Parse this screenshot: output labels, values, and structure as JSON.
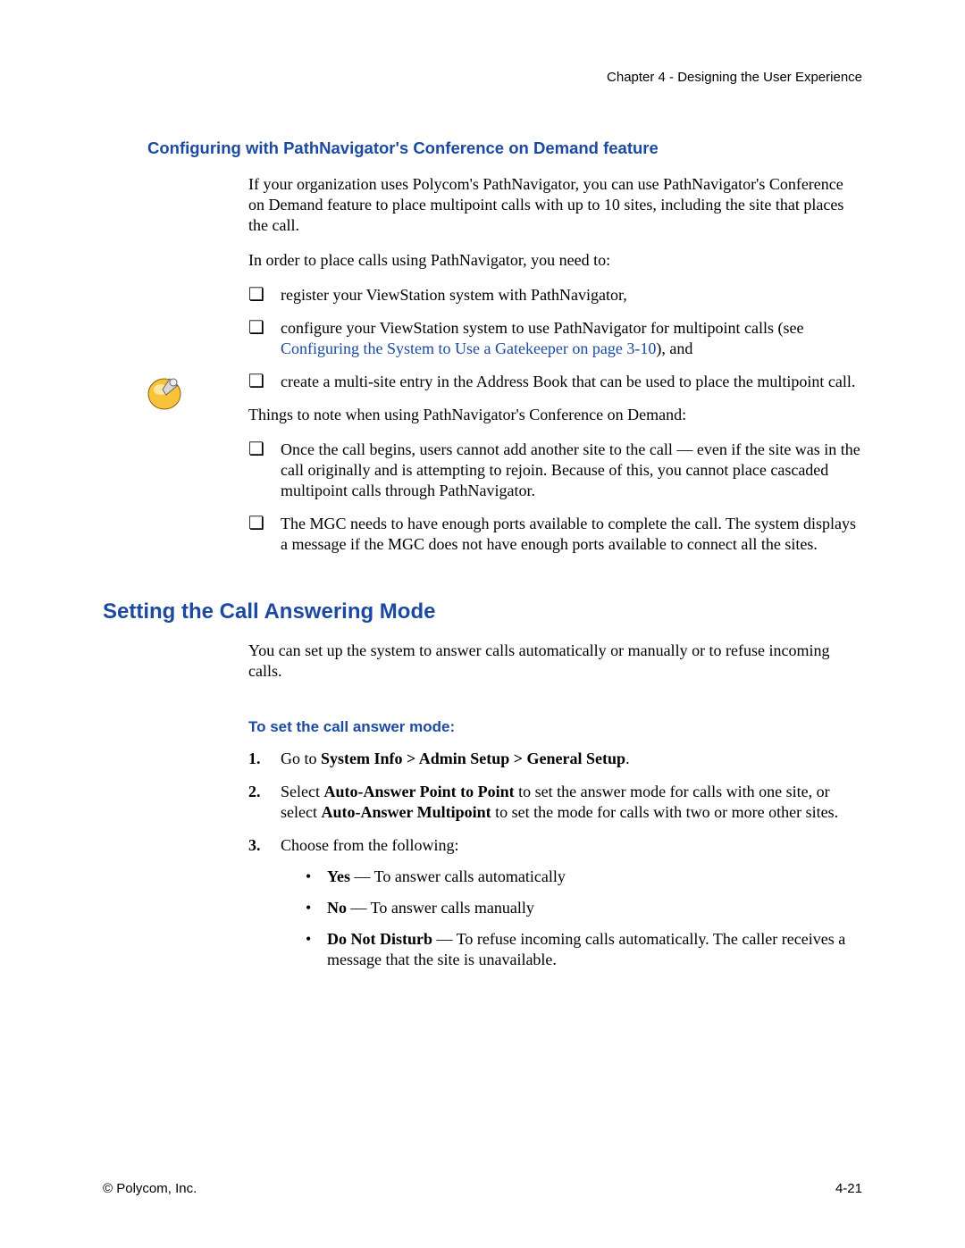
{
  "header": {
    "chapterLine": "Chapter 4 - Designing the User Experience"
  },
  "section1": {
    "heading": "Configuring with PathNavigator's Conference on Demand feature",
    "para1": "If your organization uses Polycom's PathNavigator, you can use PathNavigator's Conference on Demand feature to place multipoint calls with up to 10 sites, including the site that places the call.",
    "para2": "In order to place calls using PathNavigator, you need to:",
    "checks1": [
      "register your ViewStation system with PathNavigator,",
      {
        "pre": "configure your ViewStation system to use PathNavigator for multipoint calls (see ",
        "link": "Configuring the System to Use a Gatekeeper on page 3-10",
        "post": "), and"
      },
      "create a multi-site entry in the Address Book that can be used to place the multipoint call."
    ],
    "para3": "Things to note when using PathNavigator's Conference on Demand:",
    "checks2": [
      "Once the call begins, users cannot add another site to the call — even if the site was in the call originally and is attempting to rejoin. Because of this, you cannot place cascaded multipoint calls through PathNavigator.",
      "The MGC needs to have enough ports available to complete the call. The system displays a message if the MGC does not have enough ports available to connect all the sites."
    ]
  },
  "section2": {
    "heading": "Setting the Call Answering Mode",
    "para1": "You can set up the system to answer calls automatically or manually or to refuse incoming calls.",
    "subheading": "To set the call answer mode:",
    "steps": [
      {
        "num": "1.",
        "pre": "Go to ",
        "bold": "System Info > Admin Setup > General Setup",
        "post": "."
      },
      {
        "num": "2.",
        "pre": "Select ",
        "bold": "Auto-Answer Point to Point",
        "mid": " to set the answer mode for calls with one site, or select ",
        "bold2": "Auto-Answer Multipoint",
        "post": " to set the mode for calls with two or more other sites."
      },
      {
        "num": "3.",
        "text": "Choose from the following:",
        "bullets": [
          {
            "bold": "Yes",
            "text": " — To answer calls automatically"
          },
          {
            "bold": "No",
            "text": " — To answer calls manually"
          },
          {
            "bold": "Do Not Disturb",
            "text": " — To refuse incoming calls automatically. The caller receives a message that the site is unavailable."
          }
        ]
      }
    ]
  },
  "footer": {
    "left": "© Polycom, Inc.",
    "right": "4-21"
  }
}
